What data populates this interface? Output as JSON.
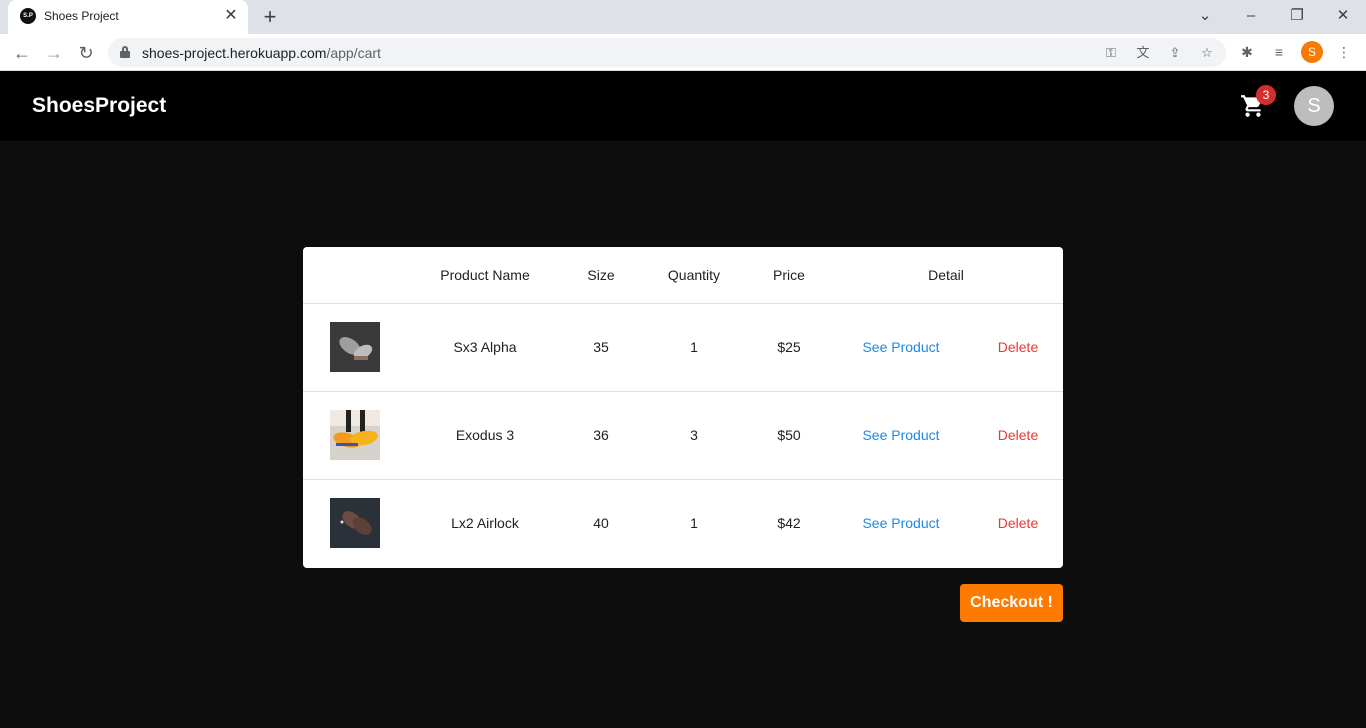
{
  "browser": {
    "tab_title": "Shoes Project",
    "favicon_text": "S.P",
    "url_host": "shoes-project.herokuapp.com",
    "url_path": "/app/cart",
    "profile_initial": "S"
  },
  "header": {
    "brand": "ShoesProject",
    "cart_count": "3",
    "avatar_initial": "S"
  },
  "cart": {
    "columns": {
      "product_name": "Product Name",
      "size": "Size",
      "quantity": "Quantity",
      "price": "Price",
      "detail": "Detail"
    },
    "see_label": "See Product",
    "delete_label": "Delete",
    "items": [
      {
        "name": "Sx3 Alpha",
        "size": "35",
        "quantity": "1",
        "price": "$25"
      },
      {
        "name": "Exodus 3",
        "size": "36",
        "quantity": "3",
        "price": "$50"
      },
      {
        "name": "Lx2 Airlock",
        "size": "40",
        "quantity": "1",
        "price": "$42"
      }
    ]
  },
  "checkout_label": "Checkout !",
  "colors": {
    "accent": "#ff7a00",
    "link": "#1e88e5",
    "danger": "#e53935",
    "badge": "#d32f2f",
    "header_bg": "#000000",
    "page_bg": "#0d0d0d"
  }
}
